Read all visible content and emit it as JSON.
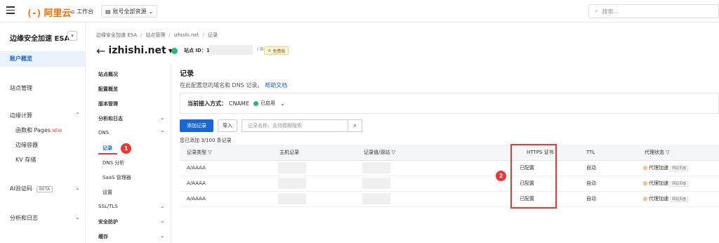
{
  "topbar": {
    "logo_text": "阿里云",
    "logo_bracket": "(-)",
    "workspace_label": "工作台",
    "resource_label": "账号全部资源",
    "search_placeholder": "搜索..."
  },
  "sidebar": {
    "title": "边缘安全加速 ESA",
    "collapse_icon": "chevron-down-icon",
    "items": [
      {
        "label": "账户概览"
      },
      {
        "label": "站点管理"
      },
      {
        "label": "边缘计算"
      },
      {
        "label": "函数和 Pages",
        "badge": "NEW"
      },
      {
        "label": "边缘容器"
      },
      {
        "label": "KV 存储"
      },
      {
        "label": "AI验证码",
        "badge": "BETA"
      },
      {
        "label": "分析和日志"
      }
    ]
  },
  "breadcrumb": [
    "边缘安全加速 ESA",
    "站点管理",
    "izhishi.net",
    "记录"
  ],
  "site": {
    "name": "izhishi.net",
    "id_label": "站点 ID：1",
    "id_suffix": "i",
    "plan": "免费版"
  },
  "subnav": {
    "items": [
      {
        "label": "站点概况"
      },
      {
        "label": "配置概览"
      },
      {
        "label": "版本管理"
      },
      {
        "label": "分析和日志"
      },
      {
        "label": "DNS"
      },
      {
        "label": "记录"
      },
      {
        "label": "DNS 分析"
      },
      {
        "label": "SaaS 管理器"
      },
      {
        "label": "设置"
      },
      {
        "label": "SSL/TLS"
      },
      {
        "label": "安全防护"
      },
      {
        "label": "缓存"
      }
    ]
  },
  "markers": [
    "1",
    "2"
  ],
  "content": {
    "title": "记录",
    "desc": "在此配置您的域名和 DNS 记录。",
    "help_link": "帮助文档",
    "access_label": "当前接入方式：",
    "access_value": "CNAME",
    "access_status": "已启用",
    "add_button": "添加记录",
    "import_button": "导入",
    "search_placeholder": "记录名称、支持模糊搜索",
    "count_text": "您已添加 3/100 条记录"
  },
  "table": {
    "headers": [
      "记录类型",
      "主机记录",
      "记录值/源站",
      "HTTPS 证书",
      "TTL",
      "代理状态"
    ],
    "rows": [
      {
        "type": "A/AAAA",
        "https": "已配置",
        "ttl": "自动",
        "proxy": "代理加速",
        "proxy_sub": "网站页面"
      },
      {
        "type": "A/AAAA",
        "https": "已配置",
        "ttl": "自动",
        "proxy": "代理加速",
        "proxy_sub": "网站页面"
      },
      {
        "type": "A/AAAA",
        "https": "已配置",
        "ttl": "自动",
        "proxy": "代理加速",
        "proxy_sub": "网站页面"
      }
    ]
  }
}
